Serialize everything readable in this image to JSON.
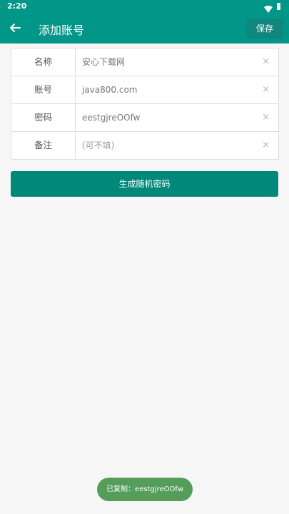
{
  "status_bar": {
    "time": "2:20"
  },
  "toolbar": {
    "title": "添加账号",
    "save_label": "保存"
  },
  "form": {
    "rows": [
      {
        "label": "名称",
        "value": "安心下载网"
      },
      {
        "label": "账号",
        "value": "java800.com"
      },
      {
        "label": "密码",
        "value": "eestgjreOOfw"
      },
      {
        "label": "备注",
        "value": "",
        "placeholder": "(可不填)"
      }
    ],
    "clear_symbol": "×"
  },
  "generate_button_label": "生成随机密码",
  "toast": "已复制：eestgjreOOfw",
  "colors": {
    "primary": "#009688",
    "button": "#00897b",
    "toast": "#559d5b"
  },
  "icons": [
    "wifi-icon",
    "battery-icon",
    "back-arrow-icon",
    "clear-icon"
  ]
}
